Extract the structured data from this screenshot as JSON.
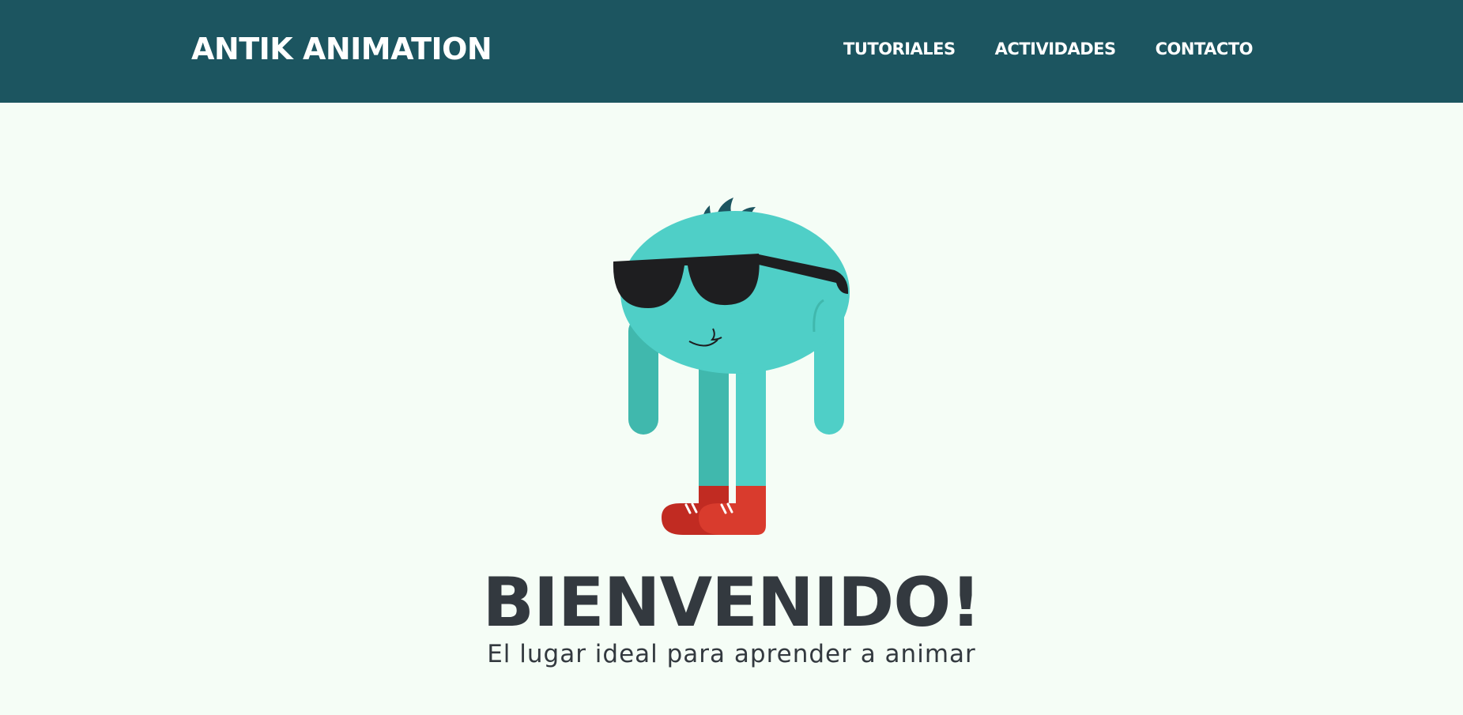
{
  "header": {
    "brand": "ANTIK ANIMATION",
    "nav": [
      {
        "label": "TUTORIALES"
      },
      {
        "label": "ACTIVIDADES"
      },
      {
        "label": "CONTACTO"
      }
    ]
  },
  "hero": {
    "title": "BIENVENIDO!",
    "subtitle": "El lugar ideal para aprender a animar"
  },
  "colors": {
    "header_bg": "#1c5560",
    "page_bg": "#f5fdf6",
    "text": "#33393f",
    "mascot_body": "#4fcfc7",
    "mascot_shade": "#40b8ad",
    "mascot_hair": "#1c5560",
    "sunglasses": "#1e1e20",
    "shoes": "#d93b2d"
  },
  "icons": [
    "mascot-illustration"
  ]
}
